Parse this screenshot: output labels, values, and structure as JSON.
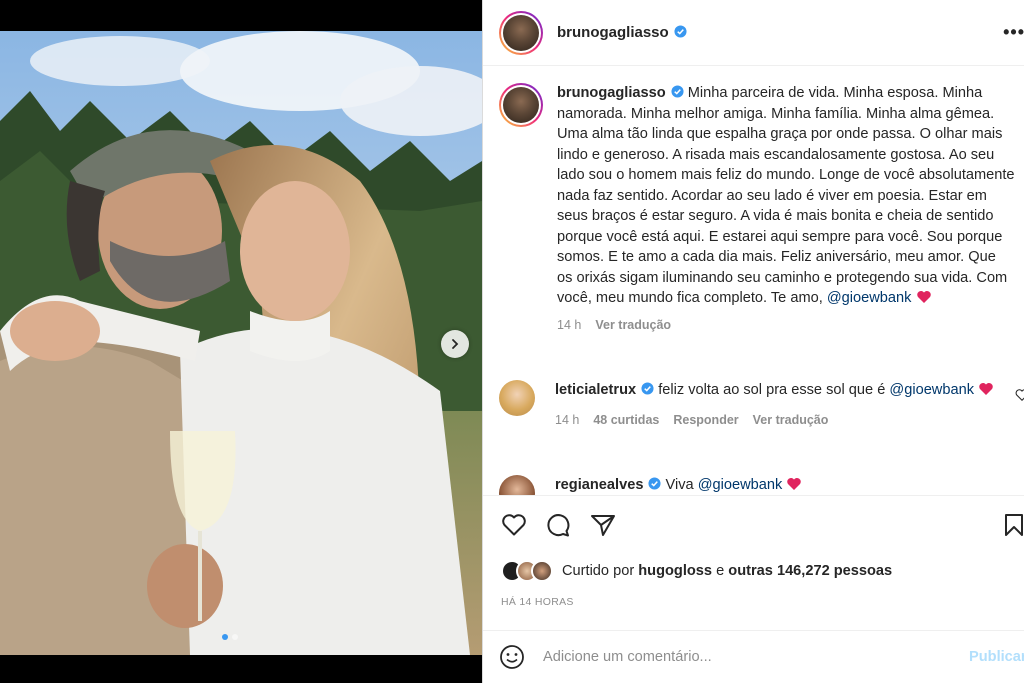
{
  "post": {
    "username": "brunogagliasso",
    "more_label": "•••"
  },
  "caption": {
    "username": "brunogagliasso",
    "text": "Minha parceira de vida. Minha esposa. Minha namorada. Minha melhor amiga. Minha família. Minha alma gêmea. Uma alma tão linda que espalha graça por onde passa. O olhar mais lindo e generoso. A risada mais escandalosamente gostosa. Ao seu lado sou o homem mais feliz do mundo. Longe de você absolutamente nada faz sentido. Acordar ao seu lado é viver em poesia. Estar em seus braços é estar seguro. A vida é mais bonita e cheia de sentido porque você está aqui. E estarei aqui sempre para você. Sou porque somos. E te amo a cada dia mais. Feliz aniversário, meu amor. Que os orixás sigam iluminando seu caminho e protegendo sua vida. Com você, meu mundo fica completo. Te amo,",
    "mention": "@gioewbank",
    "time": "14 h",
    "translate": "Ver tradução"
  },
  "comments": [
    {
      "username": "leticialetrux",
      "text": "feliz volta ao sol pra esse sol que é",
      "mention": "@gioewbank",
      "time": "14 h",
      "likes": "48 curtidas",
      "reply": "Responder",
      "translate": "Ver tradução"
    },
    {
      "username": "regianealves",
      "text": "Viva",
      "mention": "@gioewbank"
    }
  ],
  "likes": {
    "prefix": "Curtido por",
    "user": "hugogloss",
    "connector": "e",
    "others": "outras 146,272 pessoas"
  },
  "timestamp": "HÁ 14 HORAS",
  "add_comment": {
    "placeholder": "Adicione um comentário...",
    "publish": "Publicar"
  },
  "colors": {
    "verified": "#3897f0",
    "heart": "#ed4956",
    "publish_disabled": "#b2dffc",
    "mention": "#00376b"
  },
  "icons": [
    "verified-icon",
    "heart-icon",
    "comment-icon",
    "share-icon",
    "bookmark-icon",
    "emoji-icon",
    "chevron-right-icon",
    "more-icon"
  ]
}
